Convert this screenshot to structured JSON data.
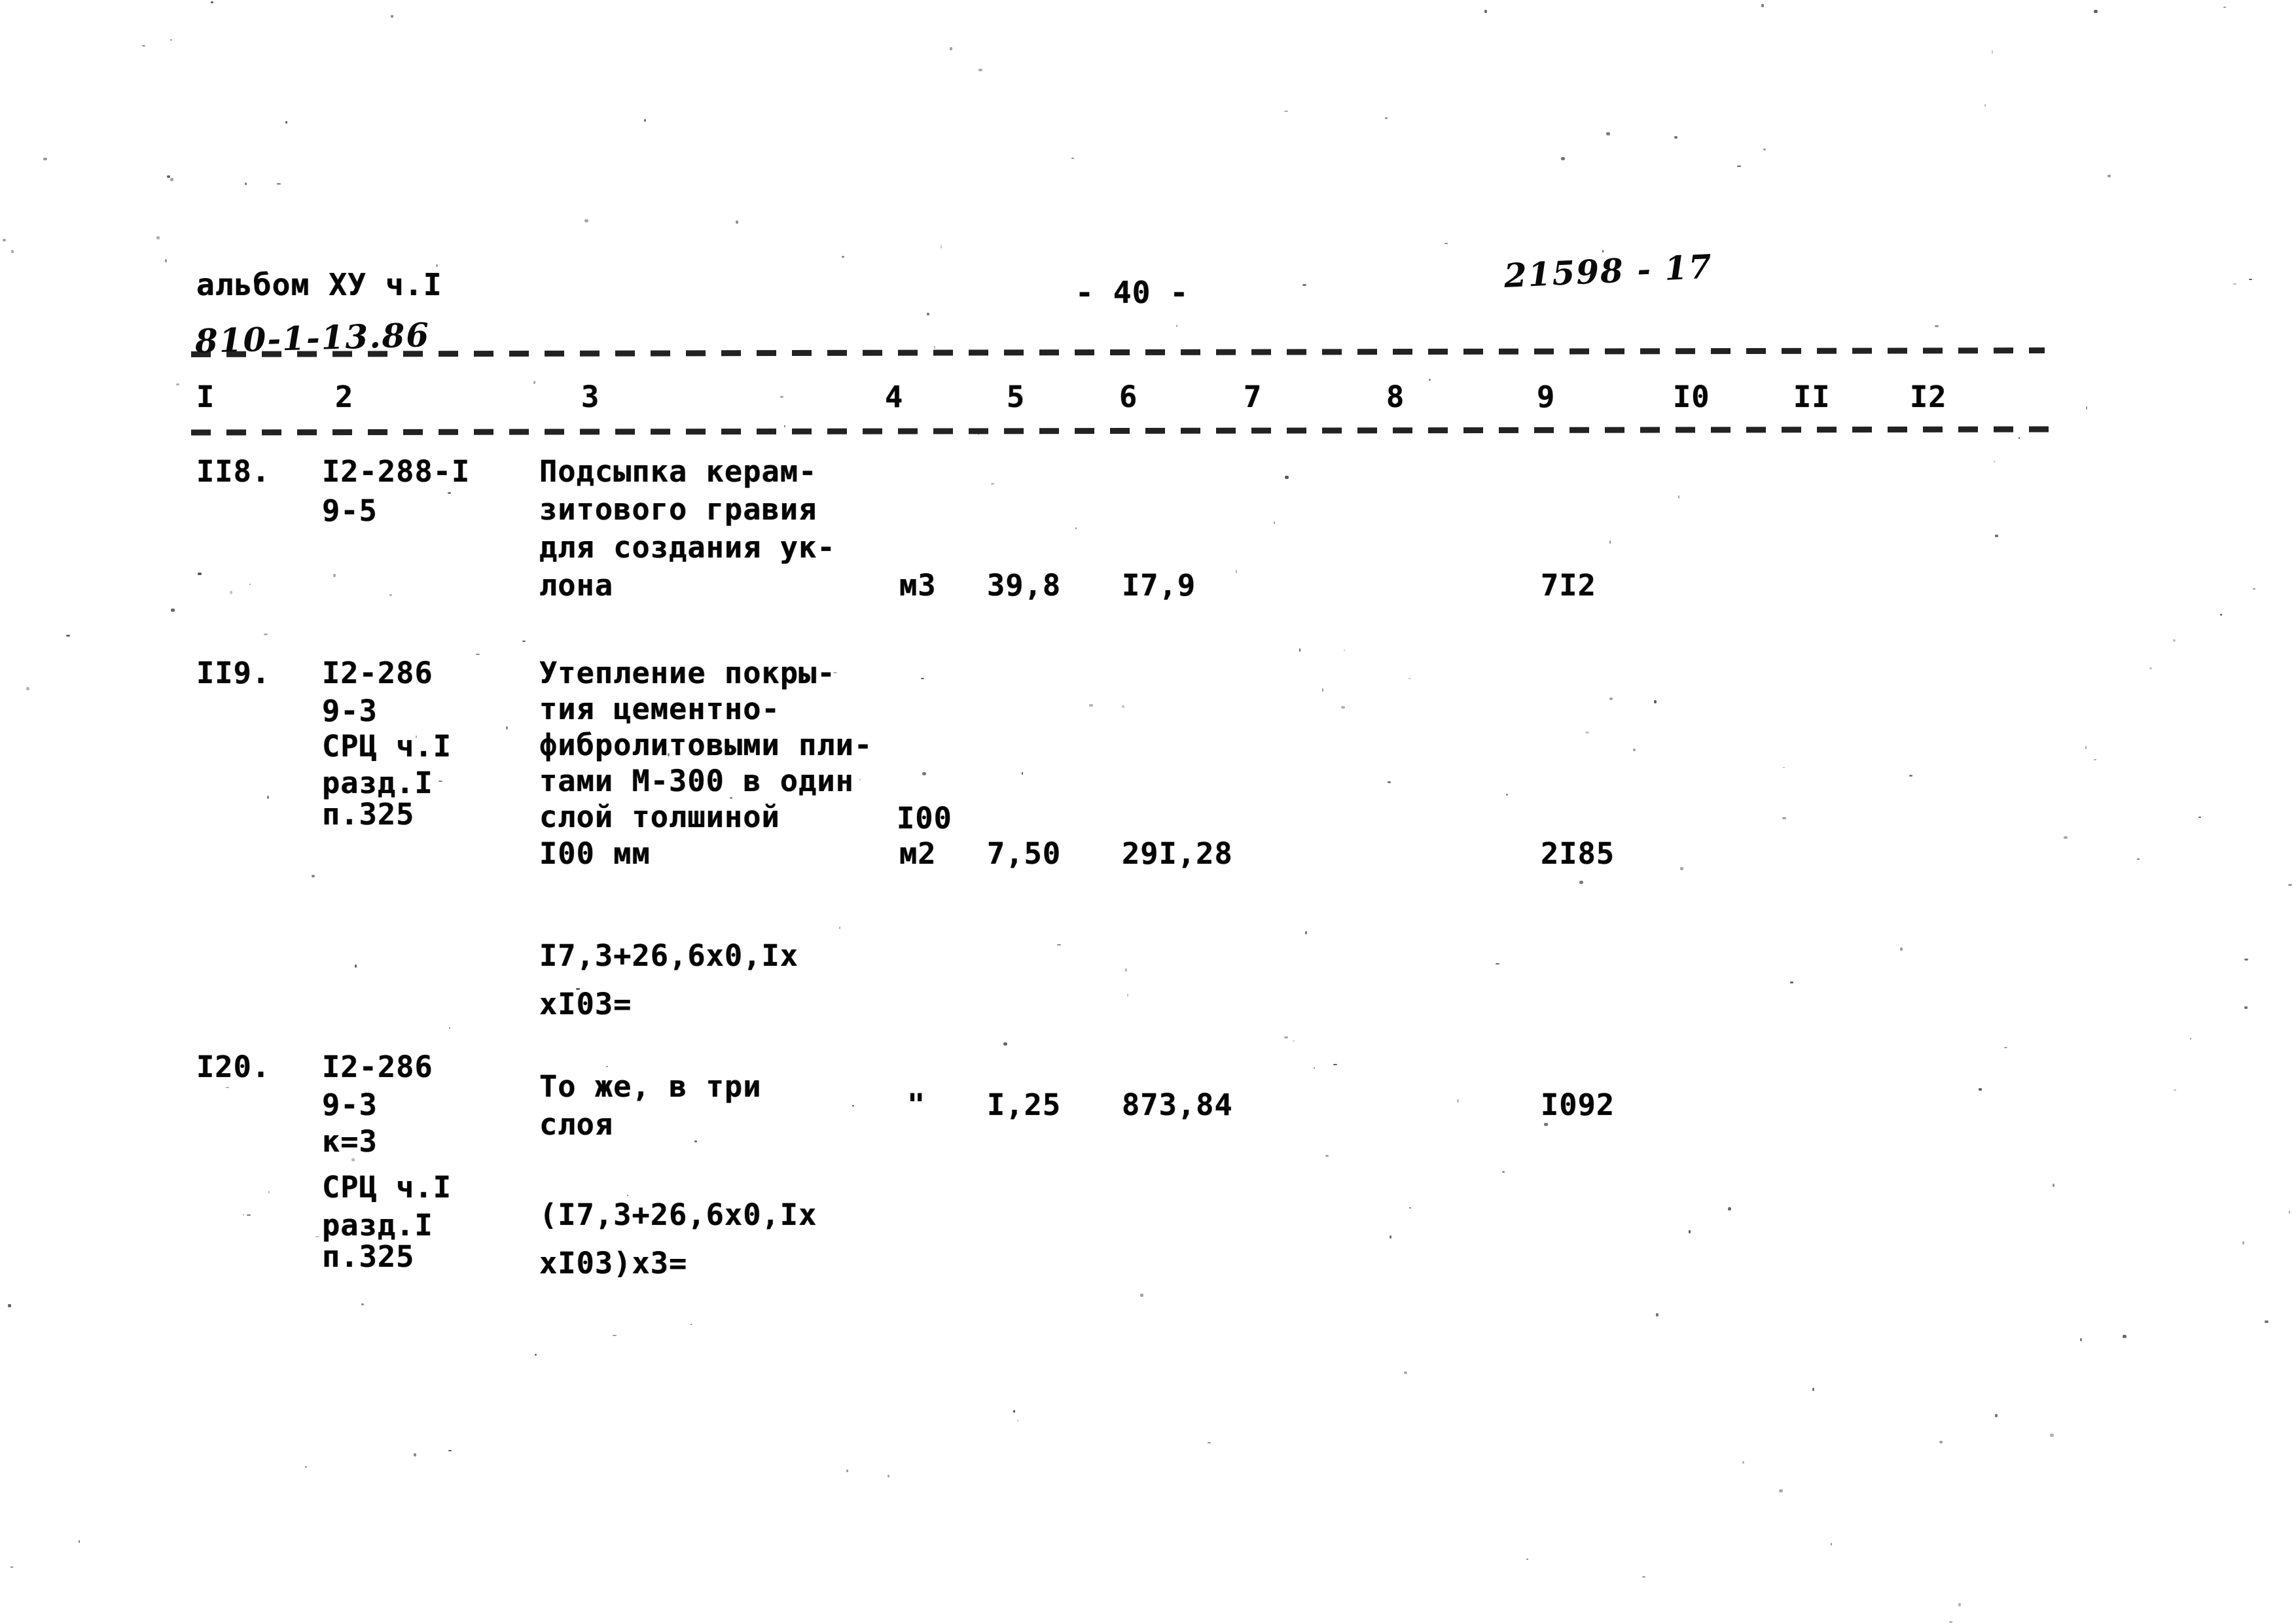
{
  "document": {
    "header": {
      "album_line": "альбом ХУ ч.I",
      "album_code_handwritten": "810-1-13.86",
      "page_marker": "- 40 -",
      "archive_code_handwritten": "21598 - 17"
    },
    "column_headers": [
      "I",
      "2",
      "3",
      "4",
      "5",
      "6",
      "7",
      "8",
      "9",
      "I0",
      "II",
      "I2"
    ],
    "rows": [
      {
        "no": "II8.",
        "code_lines": [
          "I2-288-I",
          "9-5"
        ],
        "description_lines": [
          "Подсыпка керам-",
          "зитового гравия",
          "для создания ук-",
          "лона"
        ],
        "unit": "м3",
        "col5": "39,8",
        "col6": "I7,9",
        "col9": "7I2",
        "formula_lines": []
      },
      {
        "no": "II9.",
        "code_lines": [
          "I2-286",
          "9-3",
          "СРЦ ч.I",
          "разд.I",
          "п.325"
        ],
        "description_lines": [
          "Утепление покры-",
          "тия цементно-",
          "фибролитовыми пли-",
          "тами М-300 в один",
          "слой толшиной",
          "I00 мм"
        ],
        "unit_prefix": "I00",
        "unit": "м2",
        "col5": "7,50",
        "col6": "29I,28",
        "col9": "2I85",
        "formula_lines": [
          "I7,3+26,6х0,Iх",
          "хI03="
        ]
      },
      {
        "no": "I20.",
        "code_lines": [
          "I2-286",
          "9-3",
          "к=3",
          "СРЦ ч.I",
          "разд.I",
          "п.325"
        ],
        "description_lines": [
          "То же, в три",
          "слоя"
        ],
        "unit": "\"",
        "col5": "I,25",
        "col6": "873,84",
        "col9": "I092",
        "formula_lines": [
          "(I7,3+26,6х0,Iх",
          "хI03)х3="
        ]
      }
    ]
  }
}
